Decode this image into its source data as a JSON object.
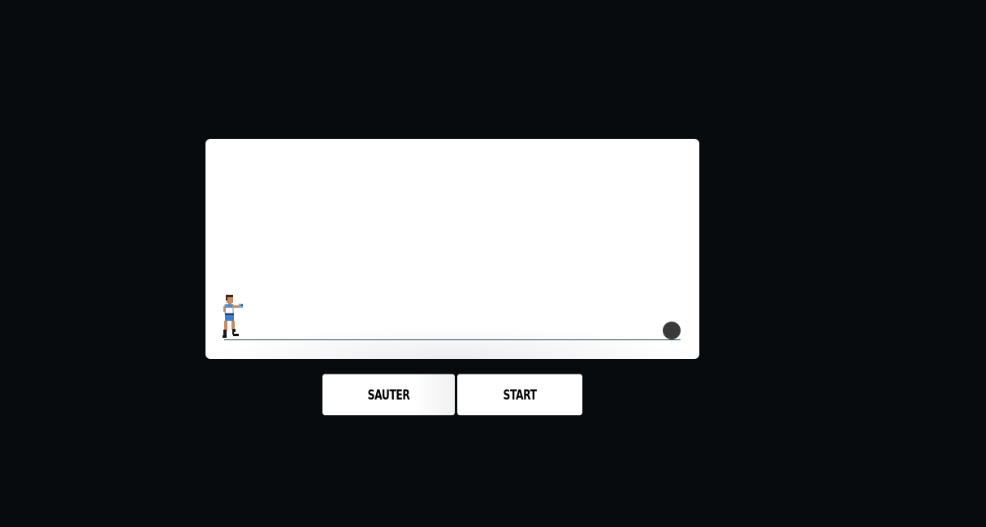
{
  "controls": {
    "jump_label": "SAUTER",
    "start_label": "START"
  },
  "colors": {
    "background": "#080b0d",
    "panel": "#ffffff",
    "ground": "#2d4a5c",
    "obstacle": "#3a3a3a",
    "player_shirt": "#4a90d9"
  },
  "icons": {
    "player": "boxer-sprite-icon",
    "obstacle": "ball-icon"
  }
}
